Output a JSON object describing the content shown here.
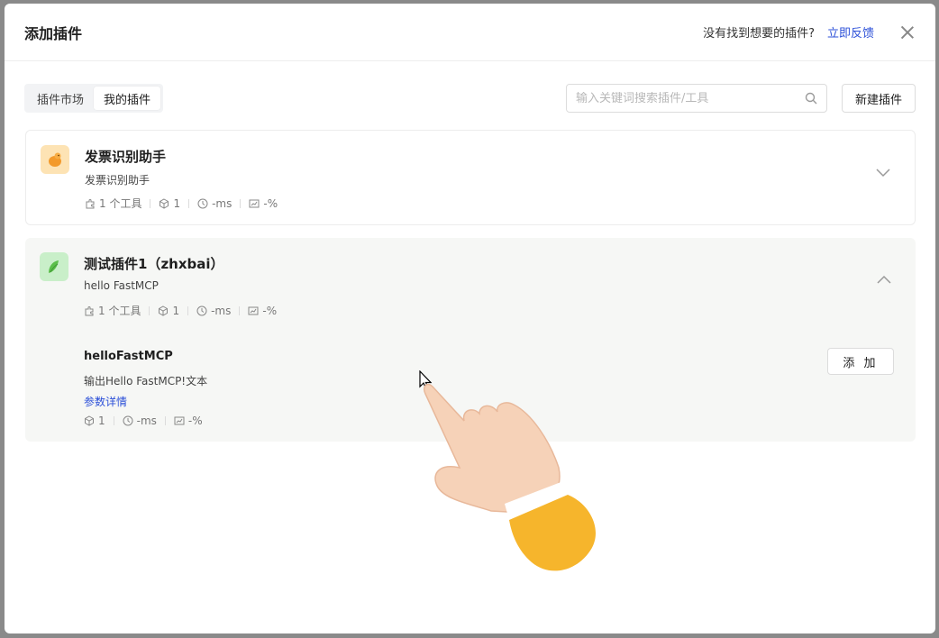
{
  "modal": {
    "title": "添加插件",
    "feedback_hint": "没有找到想要的插件?",
    "feedback_link": "立即反馈"
  },
  "tabs": [
    {
      "label": "插件市场",
      "active": false
    },
    {
      "label": "我的插件",
      "active": true
    }
  ],
  "search": {
    "placeholder": "输入关键词搜索插件/工具",
    "value": ""
  },
  "new_plugin_label": "新建插件",
  "plugins": [
    {
      "name": "发票识别助手",
      "description": "发票识别助手",
      "tools_count": "1 个工具",
      "usage": "1",
      "latency": "-ms",
      "success_rate": "-%",
      "expanded": false,
      "icon": "orange-duck-icon"
    },
    {
      "name": "测试插件1（zhxbai）",
      "description": "hello FastMCP",
      "tools_count": "1 个工具",
      "usage": "1",
      "latency": "-ms",
      "success_rate": "-%",
      "expanded": true,
      "icon": "green-bird-icon",
      "tools": [
        {
          "name": "helloFastMCP",
          "description": "输出Hello FastMCP!文本",
          "detail_link": "参数详情",
          "usage": "1",
          "latency": "-ms",
          "success_rate": "-%",
          "add_label": "添 加"
        }
      ]
    }
  ],
  "colors": {
    "link": "#2b4fd8",
    "expanded_bg": "#f6f7f5",
    "hand_cuff": "#f6b52c"
  }
}
